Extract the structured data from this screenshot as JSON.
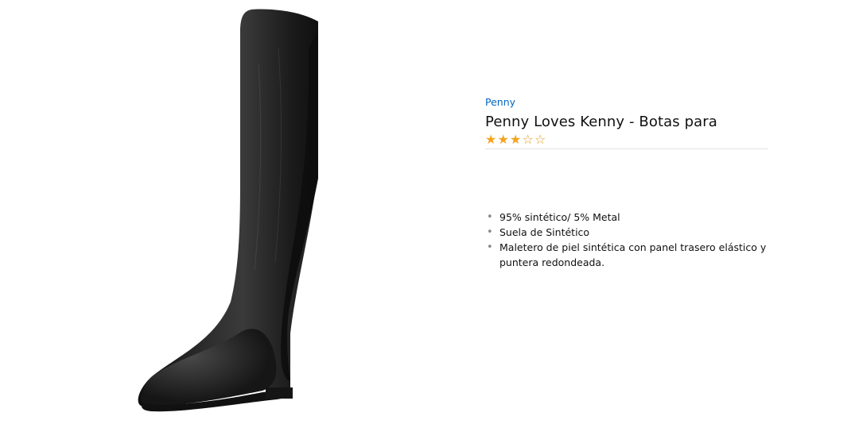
{
  "product": {
    "brand": "Penny",
    "title": "Penny Loves Kenny - Botas para",
    "rating": {
      "value": 3,
      "max": 5,
      "full_star": "★",
      "empty_star": "☆"
    },
    "image_icon": "tall-black-boot",
    "features": [
      "95% sintético/ 5% Metal",
      "Suela de Sintético",
      "Maletero de piel sintética con panel trasero elástico y puntera redondeada."
    ]
  },
  "colors": {
    "link": "#0066c0",
    "star": "#f4a31b",
    "boot": "#1b1b1b"
  }
}
